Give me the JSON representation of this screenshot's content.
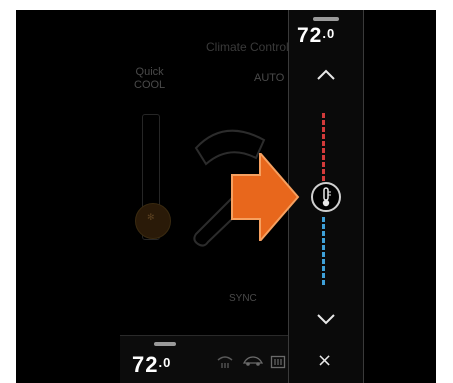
{
  "background": {
    "title": "Climate Control",
    "quick_cool": "Quick\nCOOL",
    "auto": "AUTO",
    "sync": "SYNC"
  },
  "temperature_panel": {
    "temperature_whole": "72",
    "temperature_decimal": ".0",
    "up_icon": "chevron-up-icon",
    "down_icon": "chevron-down-icon",
    "slider_icon": "thermometer-icon",
    "close_label": "×"
  },
  "bottom_bar": {
    "temperature_whole": "72",
    "temperature_decimal": ".0",
    "icons": [
      "front-defrost-icon",
      "recirculation-icon",
      "rear-defrost-icon"
    ]
  },
  "callout": {
    "color": "#e8671c"
  },
  "colors": {
    "heat": "#d23a3a",
    "cool": "#3ea0d8",
    "screen": "#000000"
  }
}
